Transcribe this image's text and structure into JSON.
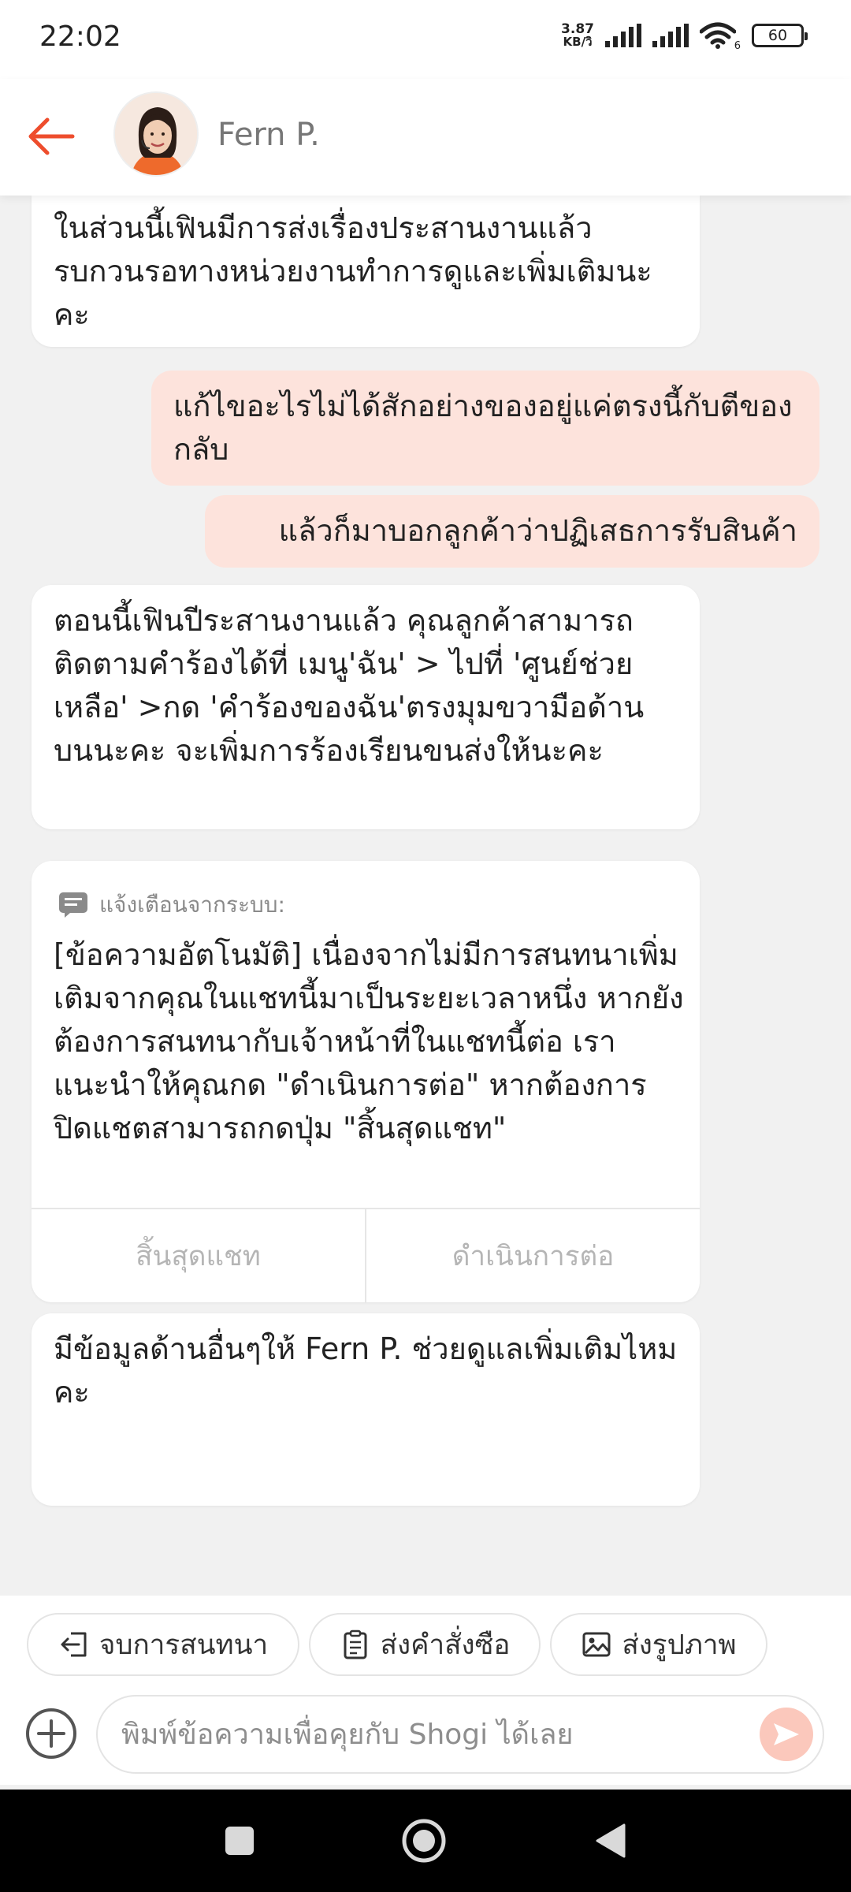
{
  "status_bar": {
    "time": "22:02",
    "net_speed_value": "3.87",
    "net_speed_unit": "KB/วิ",
    "wifi_badge": "6",
    "battery": "60"
  },
  "header": {
    "back_icon": "back-arrow-icon",
    "agent_name": "Fern P."
  },
  "messages": [
    {
      "side": "left",
      "text": "ในส่วนนี้เฟินมีการส่งเรื่องประสานงานแล้ว รบกวนรอทางหน่วยงานทำการดูและเพิ่มเติมนะคะ"
    },
    {
      "side": "right",
      "text": "แก้ไขอะไรไม่ได้สักอย่างของอยู่แค่ตรงนี้กับตีของกลับ"
    },
    {
      "side": "right",
      "text": "แล้วก็มาบอกลูกค้าว่าปฏิเสธการรับสินค้า"
    },
    {
      "side": "left",
      "text": "ตอนนี้เฟินปีระสานงานแล้ว คุณลูกค้าสามารถติดตามคำร้องได้ที่  เมนู'ฉัน' > ไปที่ 'ศูนย์ช่วยเหลือ' >กด 'คำร้องของฉัน'ตรงมุมขวามือด้านบนนะคะ  จะเพิ่มการร้องเรียนขนส่งให้นะคะ"
    },
    {
      "side": "left",
      "text": "มีข้อมูลด้านอื่นๆให้  Fern P.  ช่วยดูแลเพิ่มเติมไหมคะ"
    }
  ],
  "system_notice": {
    "icon": "message-icon",
    "label": "แจ้งเตือนจากระบบ:",
    "body": "[ข้อความอัตโนมัติ] เนื่องจากไม่มีการสนทนาเพิ่มเติมจากคุณในแชทนี้มาเป็นระยะเวลาหนึ่ง หากยังต้องการสนทนากับเจ้าหน้าที่ในแชทนี้ต่อ เราแนะนำให้คุณกด \"ดำเนินการต่อ\" หากต้องการปิดแชตสามารถกดปุ่ม \"สิ้นสุดแชท\"",
    "end_button": "สิ้นสุดแชท",
    "continue_button": "ดำเนินการต่อ"
  },
  "quick_actions": [
    {
      "icon": "exit-icon",
      "label": "จบการสนทนา"
    },
    {
      "icon": "clipboard-icon",
      "label": "ส่งคำสั่งซือ"
    },
    {
      "icon": "image-icon",
      "label": "ส่งรูปภาพ"
    }
  ],
  "composer": {
    "placeholder": "พิมพ์ข้อความเพื่อคุยกับ Shogi ได้เลย",
    "value": ""
  },
  "colors": {
    "accent": "#ee4d2d",
    "outgoing_bubble": "#fde3dc",
    "send_button": "#fbc8bc",
    "background": "#f1f1f1"
  }
}
